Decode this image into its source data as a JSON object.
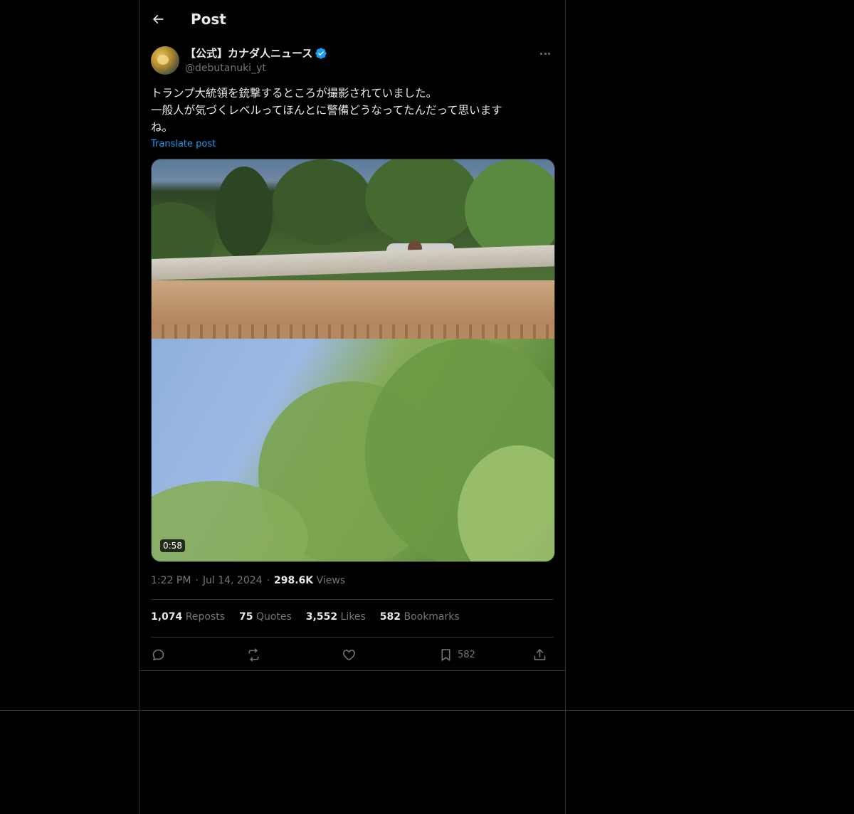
{
  "header": {
    "title": "Post",
    "back_icon": "arrow-left-icon"
  },
  "author": {
    "display_name": "【公式】カナダ人ニュース",
    "handle": "@debutanuki_yt",
    "verified": true,
    "verified_color": "#1d9bf0"
  },
  "post": {
    "text": "トランプ大統領を銃撃するところが撮影されていました。\n一般人が気づくレベルってほんとに警備どうなってたんだって思います\nね。",
    "translate_label": "Translate post",
    "video_duration": "0:58"
  },
  "meta": {
    "time": "1:22 PM",
    "separator": "·",
    "date": "Jul 14, 2024",
    "views_count": "298.6K",
    "views_label": "Views"
  },
  "stats": {
    "reposts_count": "1,074",
    "reposts_label": "Reposts",
    "quotes_count": "75",
    "quotes_label": "Quotes",
    "likes_count": "3,552",
    "likes_label": "Likes",
    "bookmarks_count": "582",
    "bookmarks_label": "Bookmarks"
  },
  "actions": {
    "reply_icon": "reply-icon",
    "repost_icon": "repost-icon",
    "like_icon": "heart-icon",
    "bookmark_icon": "bookmark-icon",
    "bookmark_count": "582",
    "share_icon": "share-icon"
  },
  "colors": {
    "background": "#000000",
    "text": "#e7e9ea",
    "muted": "#71767b",
    "accent": "#1d9bf0",
    "border": "#2f3336"
  }
}
